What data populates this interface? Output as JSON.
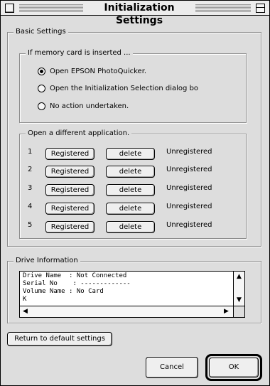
{
  "window": {
    "title": "Initialization Settings",
    "close_icon": "close-box-icon",
    "zoom_icon": "zoom-box-icon"
  },
  "basic": {
    "legend": "Basic Settings",
    "memory": {
      "legend": "If memory card is inserted ...",
      "options": [
        {
          "label": "Open EPSON PhotoQuicker.",
          "checked": true
        },
        {
          "label": "Open the Initialization Selection dialog bo",
          "checked": false
        },
        {
          "label": "No action undertaken.",
          "checked": false
        }
      ]
    },
    "apps": {
      "legend": "Open a different application.",
      "rows": [
        {
          "num": "1",
          "register": "Registered",
          "delete": "delete",
          "status": "Unregistered"
        },
        {
          "num": "2",
          "register": "Registered",
          "delete": "delete",
          "status": "Unregistered"
        },
        {
          "num": "3",
          "register": "Registered",
          "delete": "delete",
          "status": "Unregistered"
        },
        {
          "num": "4",
          "register": "Registered",
          "delete": "delete",
          "status": "Unregistered"
        },
        {
          "num": "5",
          "register": "Registered",
          "delete": "delete",
          "status": "Unregistered"
        }
      ]
    }
  },
  "drive": {
    "legend": "Drive Information",
    "text": "Drive Name  : Not Connected\nSerial No    : -------------\nVolume Name : No Card\nK"
  },
  "buttons": {
    "defaults": "Return to default settings",
    "cancel": "Cancel",
    "ok": "OK"
  },
  "colors": {
    "window_bg": "#dddddd",
    "list_bg": "#ffffff"
  }
}
